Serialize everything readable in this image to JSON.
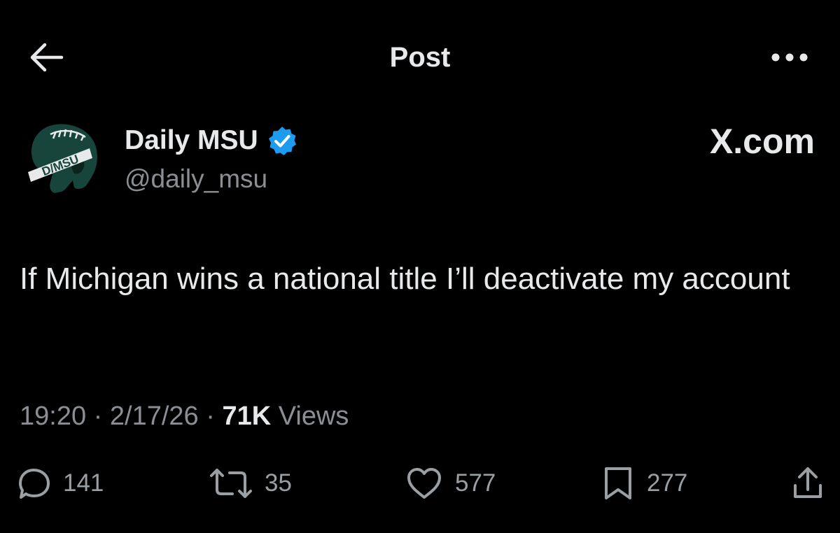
{
  "header": {
    "title": "Post",
    "back_icon": "arrow-left-icon",
    "more_icon": "more-dots-icon"
  },
  "author": {
    "name": "Daily MSU",
    "handle": "@daily_msu",
    "verified": true,
    "avatar_text": "D/MSU",
    "avatar_color": "#18453b",
    "verified_color": "#1d9bf0"
  },
  "watermark": "X.com",
  "tweet": {
    "text": "If Michigan wins a national title I’ll deactivate my account"
  },
  "meta": {
    "time": "19:20",
    "separator_1": " · ",
    "date": "2/17/26",
    "separator_2": " · ",
    "views_count": "71K",
    "views_label": "Views"
  },
  "actions": {
    "replies": "141",
    "reposts": "35",
    "likes": "577",
    "bookmarks": "277",
    "share_icon": "share-icon"
  },
  "colors": {
    "background": "#000000",
    "text_primary": "#e7e9ea",
    "text_secondary": "#8b8f94"
  }
}
